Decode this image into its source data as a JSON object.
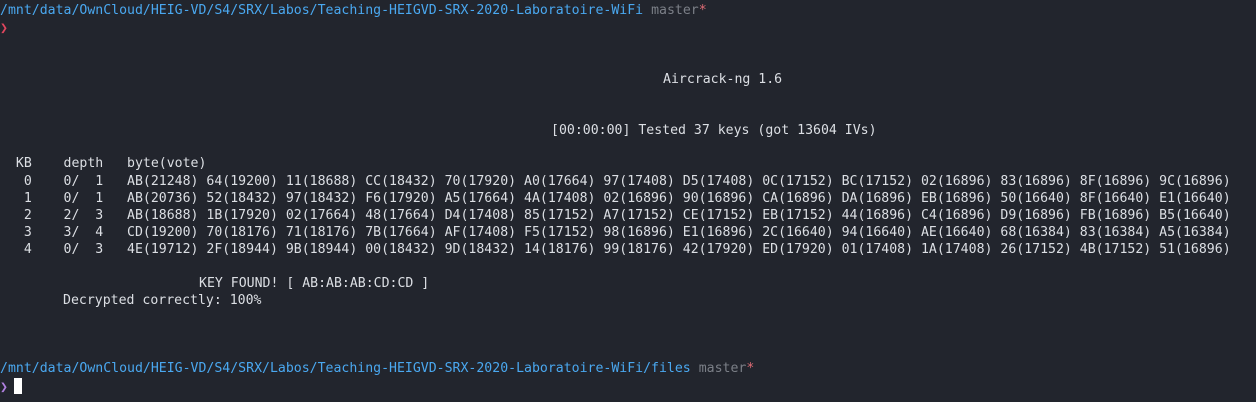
{
  "terminal": {
    "top_prompt": {
      "path": "/mnt/data/OwnCloud/HEIG-VD/S4/SRX/Labos/Teaching-HEIGVD-SRX-2020-Laboratoire-WiFi",
      "branch": "master",
      "dirty_marker": "*",
      "symbol": "❯"
    },
    "output": {
      "title": "Aircrack-ng 1.6",
      "status": "[00:00:00] Tested 37 keys (got 13604 IVs)",
      "header": "  KB    depth   byte(vote)",
      "rows": [
        "   0    0/  1   AB(21248) 64(19200) 11(18688) CC(18432) 70(17920) A0(17664) 97(17408) D5(17408) 0C(17152) BC(17152) 02(16896) 83(16896) 8F(16896) 9C(16896)",
        "   1    0/  1   AB(20736) 52(18432) 97(18432) F6(17920) A5(17664) 4A(17408) 02(16896) 90(16896) CA(16896) DA(16896) EB(16896) 50(16640) 8F(16640) E1(16640)",
        "   2    2/  3   AB(18688) 1B(17920) 02(17664) 48(17664) D4(17408) 85(17152) A7(17152) CE(17152) EB(17152) 44(16896) C4(16896) D9(16896) FB(16896) B5(16640)",
        "   3    3/  4   CD(19200) 70(18176) 71(18176) 7B(17664) AF(17408) F5(17152) 98(16896) E1(16896) 2C(16640) 94(16640) AE(16640) 68(16384) 83(16384) A5(16384)",
        "   4    0/  3   4E(19712) 2F(18944) 9B(18944) 00(18432) 9D(18432) 14(18176) 99(18176) 42(17920) ED(17920) 01(17408) 1A(17408) 26(17152) 4B(17152) 51(16896)"
      ],
      "key_found": "KEY FOUND! [ AB:AB:AB:CD:CD ]",
      "decrypted": "Decrypted correctly: 100%"
    },
    "bottom_prompt": {
      "path": "/mnt/data/OwnCloud/HEIG-VD/S4/SRX/Labos/Teaching-HEIGVD-SRX-2020-Laboratoire-WiFi/files",
      "branch": "master",
      "dirty_marker": "*",
      "symbol": "❯"
    }
  }
}
